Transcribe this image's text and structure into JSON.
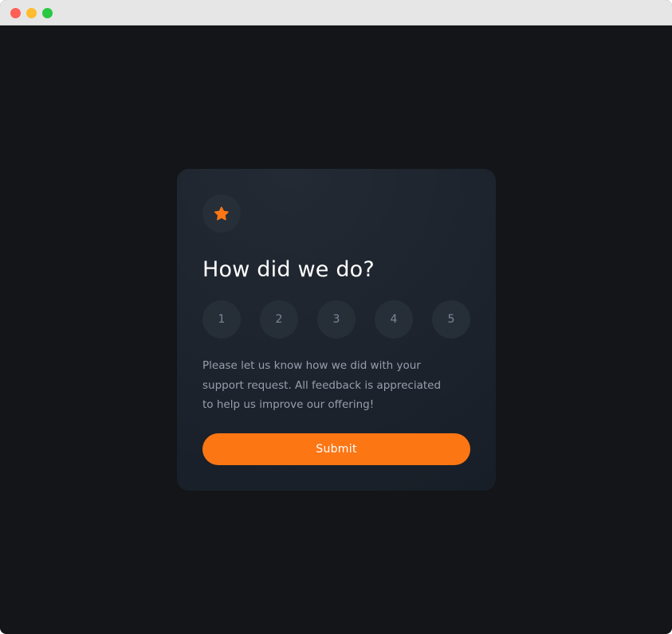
{
  "window": {
    "controls": [
      "close",
      "minimize",
      "maximize"
    ]
  },
  "card": {
    "icon": "star-icon",
    "title": "How did we do?",
    "ratings": [
      "1",
      "2",
      "3",
      "4",
      "5"
    ],
    "description": "Please let us know how we did with your support request. All feedback is appreciated to help us improve our offering!",
    "submit_label": "Submit"
  },
  "colors": {
    "accent": "#fc7614",
    "background": "#131518",
    "card": "#1e2530",
    "circle": "#262e38",
    "muted_text": "#969fad"
  }
}
